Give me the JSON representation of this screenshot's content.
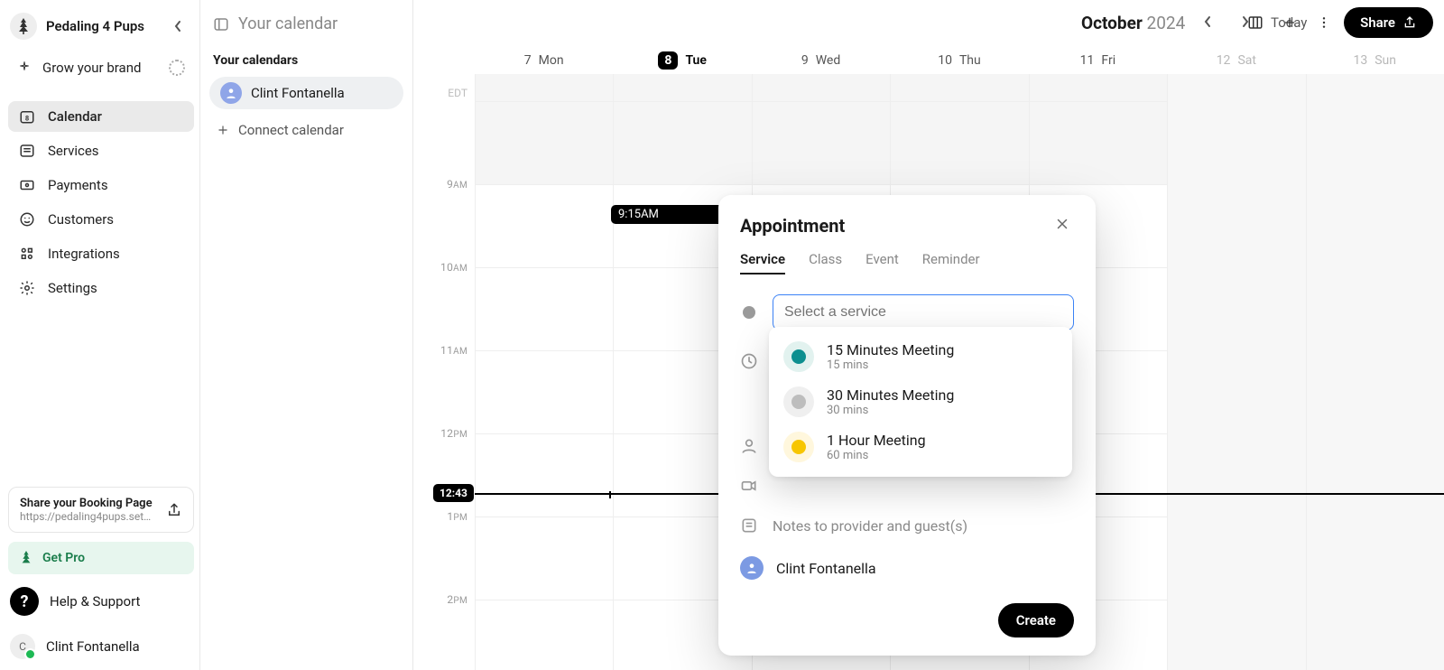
{
  "brand": {
    "name": "Pedaling 4 Pups"
  },
  "grow_brand_label": "Grow your brand",
  "nav": {
    "calendar": "Calendar",
    "services": "Services",
    "payments": "Payments",
    "customers": "Customers",
    "integrations": "Integrations",
    "settings": "Settings"
  },
  "booking_card": {
    "title": "Share your Booking Page",
    "url": "https://pedaling4pups.set…"
  },
  "get_pro": "Get Pro",
  "help": "Help & Support",
  "current_user": {
    "name": "Clint Fontanella",
    "initial": "C"
  },
  "panel2": {
    "title": "Your calendar",
    "your_calendars": "Your calendars",
    "selected_calendar": "Clint Fontanella",
    "connect": "Connect calendar"
  },
  "header": {
    "month": "October",
    "year": "2024",
    "today": "Today",
    "share": "Share"
  },
  "timezone": "EDT",
  "days": [
    {
      "num": "7",
      "name": "Mon",
      "today": false,
      "weekend": false
    },
    {
      "num": "8",
      "name": "Tue",
      "today": true,
      "weekend": false
    },
    {
      "num": "9",
      "name": "Wed",
      "today": false,
      "weekend": false
    },
    {
      "num": "10",
      "name": "Thu",
      "today": false,
      "weekend": false
    },
    {
      "num": "11",
      "name": "Fri",
      "today": false,
      "weekend": false
    },
    {
      "num": "12",
      "name": "Sat",
      "today": false,
      "weekend": true
    },
    {
      "num": "13",
      "name": "Sun",
      "today": false,
      "weekend": true
    }
  ],
  "hours": [
    {
      "h": "9",
      "ap": "AM"
    },
    {
      "h": "10",
      "ap": "AM"
    },
    {
      "h": "11",
      "ap": "AM"
    },
    {
      "h": "12",
      "ap": "PM"
    },
    {
      "h": "1",
      "ap": "PM"
    },
    {
      "h": "2",
      "ap": "PM"
    }
  ],
  "event": {
    "time_label": "9:15AM"
  },
  "now": "12:43",
  "popover": {
    "title": "Appointment",
    "tabs": {
      "service": "Service",
      "class": "Class",
      "event": "Event",
      "reminder": "Reminder"
    },
    "service_placeholder": "Select a service",
    "notes_placeholder": "Notes to provider and guest(s)",
    "assignee": "Clint Fontanella",
    "create": "Create"
  },
  "service_options": [
    {
      "name": "15 Minutes Meeting",
      "sub": "15 mins",
      "swatch_bg": "#e2f2ef",
      "swatch_dot": "#0d8f8f"
    },
    {
      "name": "30 Minutes Meeting",
      "sub": "30 mins",
      "swatch_bg": "#efefef",
      "swatch_dot": "#bdbdbd"
    },
    {
      "name": "1 Hour Meeting",
      "sub": "60 mins",
      "swatch_bg": "#fff7dd",
      "swatch_dot": "#f7c600"
    }
  ]
}
